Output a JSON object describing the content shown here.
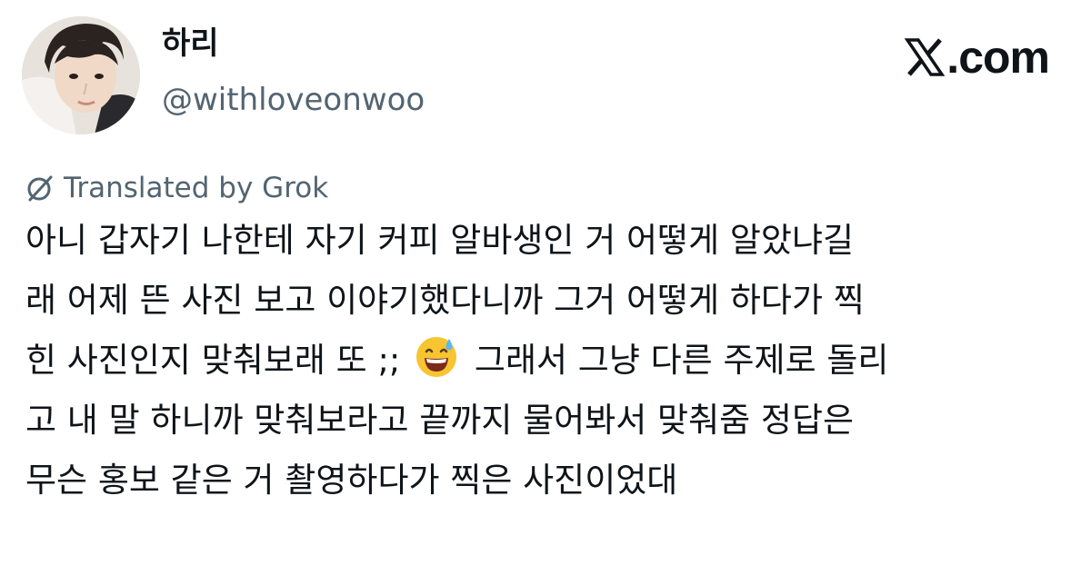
{
  "author": {
    "display_name": "하리",
    "handle": "@withloveonwoo",
    "avatar_icon": "profile-photo"
  },
  "brand": {
    "logo_icon": "x-logo-icon",
    "label": ".com"
  },
  "translation": {
    "icon": "grok-icon",
    "label": "Translated by Grok"
  },
  "tweet": {
    "lines": [
      {
        "text": "아니 갑자기 나한테 자기 커피 알바생인 거 어떻게 알았냐길"
      },
      {
        "text": "래 어제 뜬 사진 보고 이야기했다니까 그거 어떻게 하다가 찍"
      },
      {
        "before": "힌 사진인지 맞춰보래 또 ;;",
        "emoji": "grinning-face-with-sweat-emoji",
        "after": "그래서 그냥 다른 주제로 돌리"
      },
      {
        "text": "고 내 말 하니까 맞춰보라고 끝까지 물어봐서 맞춰줌 정답은"
      },
      {
        "text": "무슨 홍보 같은 거 촬영하다가 찍은 사진이었대"
      }
    ]
  },
  "colors": {
    "text": "#0f1419",
    "secondary": "#536471",
    "background": "#ffffff",
    "emoji_face": "#f7c531"
  }
}
